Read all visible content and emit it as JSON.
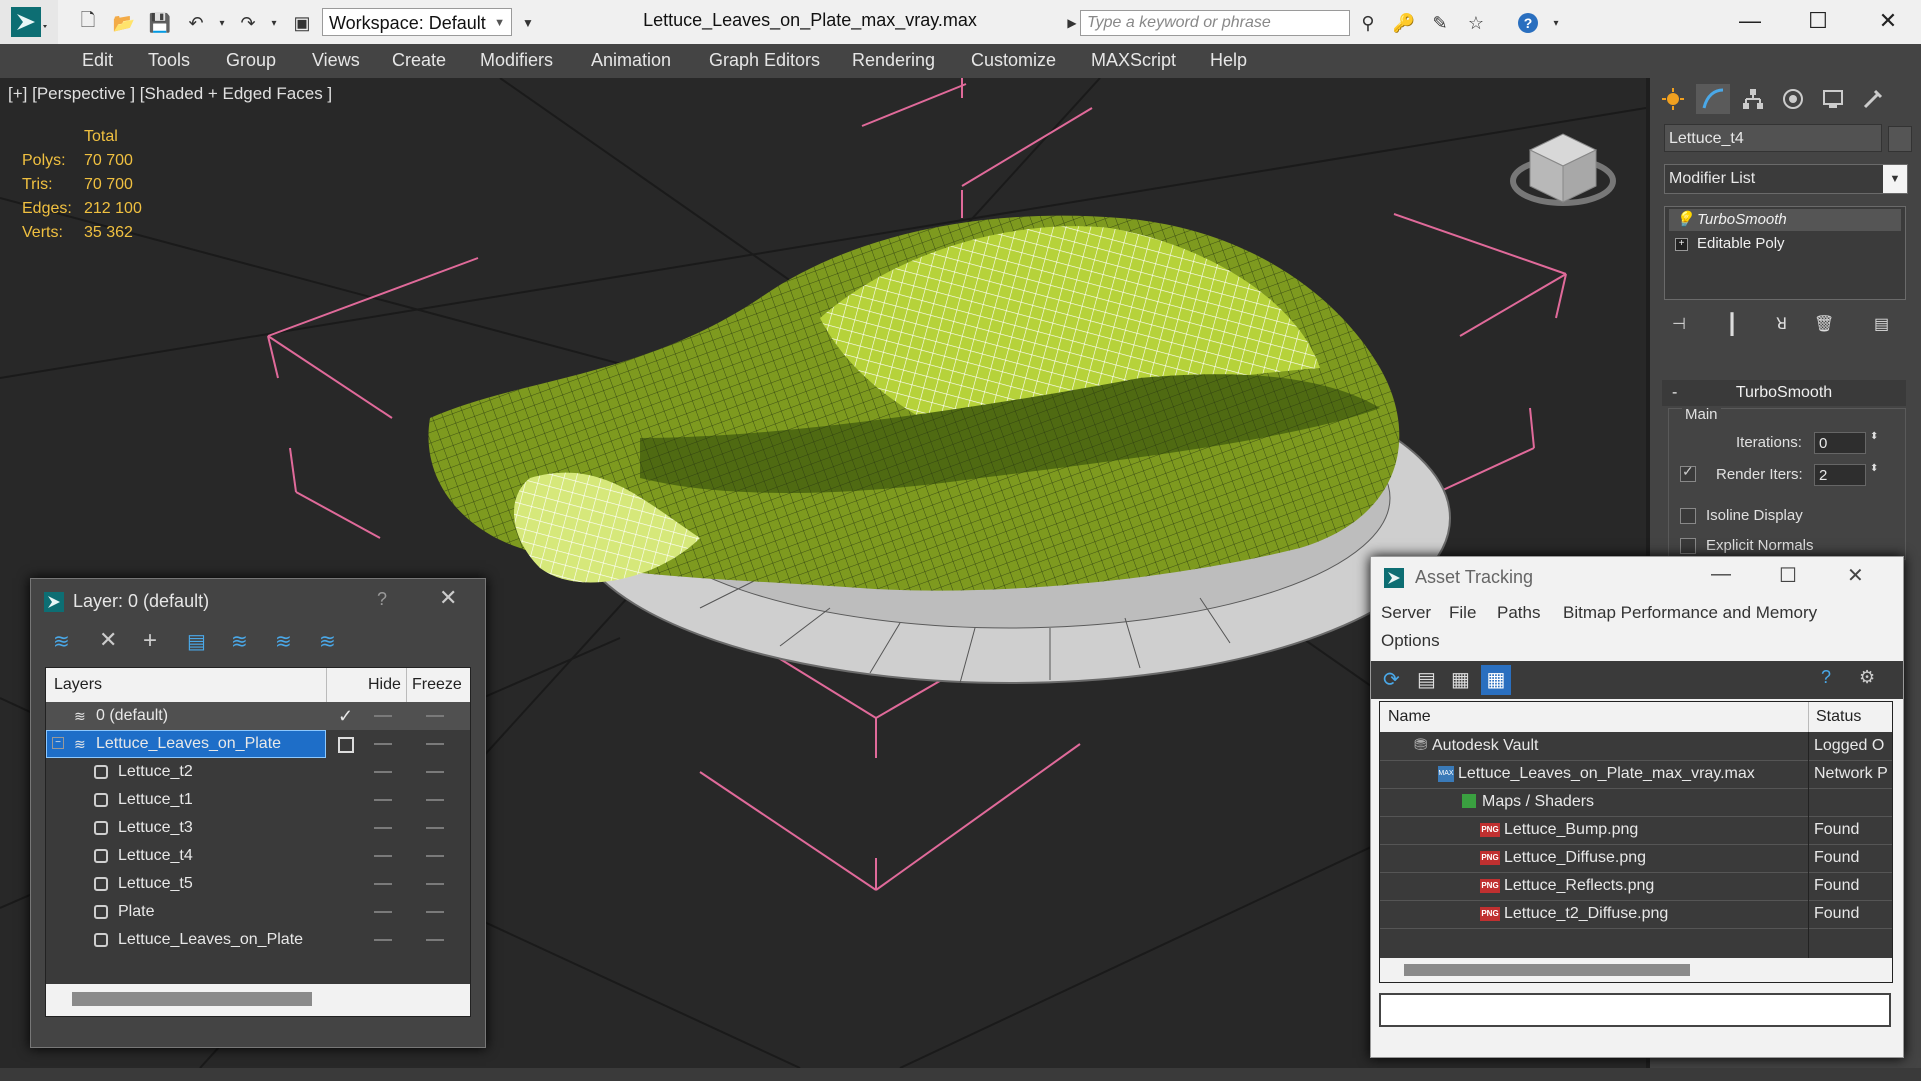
{
  "titlebar": {
    "workspace": "Workspace: Default",
    "document_title": "Lettuce_Leaves_on_Plate_max_vray.max",
    "search_placeholder": "Type a keyword or phrase"
  },
  "menu": [
    "Edit",
    "Tools",
    "Group",
    "Views",
    "Create",
    "Modifiers",
    "Animation",
    "Graph Editors",
    "Rendering",
    "Customize",
    "MAXScript",
    "Help"
  ],
  "viewport": {
    "label": "[+] [Perspective ] [Shaded + Edged Faces ]",
    "stats_header": "Total",
    "stats": [
      {
        "label": "Polys:",
        "value": "70 700"
      },
      {
        "label": "Tris:",
        "value": "70 700"
      },
      {
        "label": "Edges:",
        "value": "212 100"
      },
      {
        "label": "Verts:",
        "value": "35 362"
      }
    ]
  },
  "command_panel": {
    "object_name": "Lettuce_t4",
    "modifier_list": "Modifier List",
    "stack": [
      "TurboSmooth",
      "Editable Poly"
    ],
    "rollout_title": "TurboSmooth",
    "group_main": "Main",
    "iterations_label": "Iterations:",
    "iterations_value": "0",
    "render_iters_label": "Render Iters:",
    "render_iters_value": "2",
    "isoline_label": "Isoline Display",
    "explicit_normals_label": "Explicit Normals"
  },
  "layer_window": {
    "title": "Layer: 0 (default)",
    "help": "?",
    "columns": {
      "layers": "Layers",
      "hide": "Hide",
      "freeze": "Freeze"
    },
    "rows": [
      {
        "name": "0 (default)"
      },
      {
        "name": "Lettuce_Leaves_on_Plate"
      },
      {
        "name": "Lettuce_t2"
      },
      {
        "name": "Lettuce_t1"
      },
      {
        "name": "Lettuce_t3"
      },
      {
        "name": "Lettuce_t4"
      },
      {
        "name": "Lettuce_t5"
      },
      {
        "name": "Plate"
      },
      {
        "name": "Lettuce_Leaves_on_Plate"
      }
    ]
  },
  "asset_window": {
    "title": "Asset Tracking",
    "menu": [
      "Server",
      "File",
      "Paths",
      "Bitmap Performance and Memory",
      "Options"
    ],
    "columns": {
      "name": "Name",
      "status": "Status"
    },
    "rows": [
      {
        "name": "Autodesk Vault",
        "status": "Logged O"
      },
      {
        "name": "Lettuce_Leaves_on_Plate_max_vray.max",
        "status": "Network P"
      },
      {
        "name": "Maps / Shaders",
        "status": ""
      },
      {
        "name": "Lettuce_Bump.png",
        "status": "Found"
      },
      {
        "name": "Lettuce_Diffuse.png",
        "status": "Found"
      },
      {
        "name": "Lettuce_Reflects.png",
        "status": "Found"
      },
      {
        "name": "Lettuce_t2_Diffuse.png",
        "status": "Found"
      }
    ]
  }
}
